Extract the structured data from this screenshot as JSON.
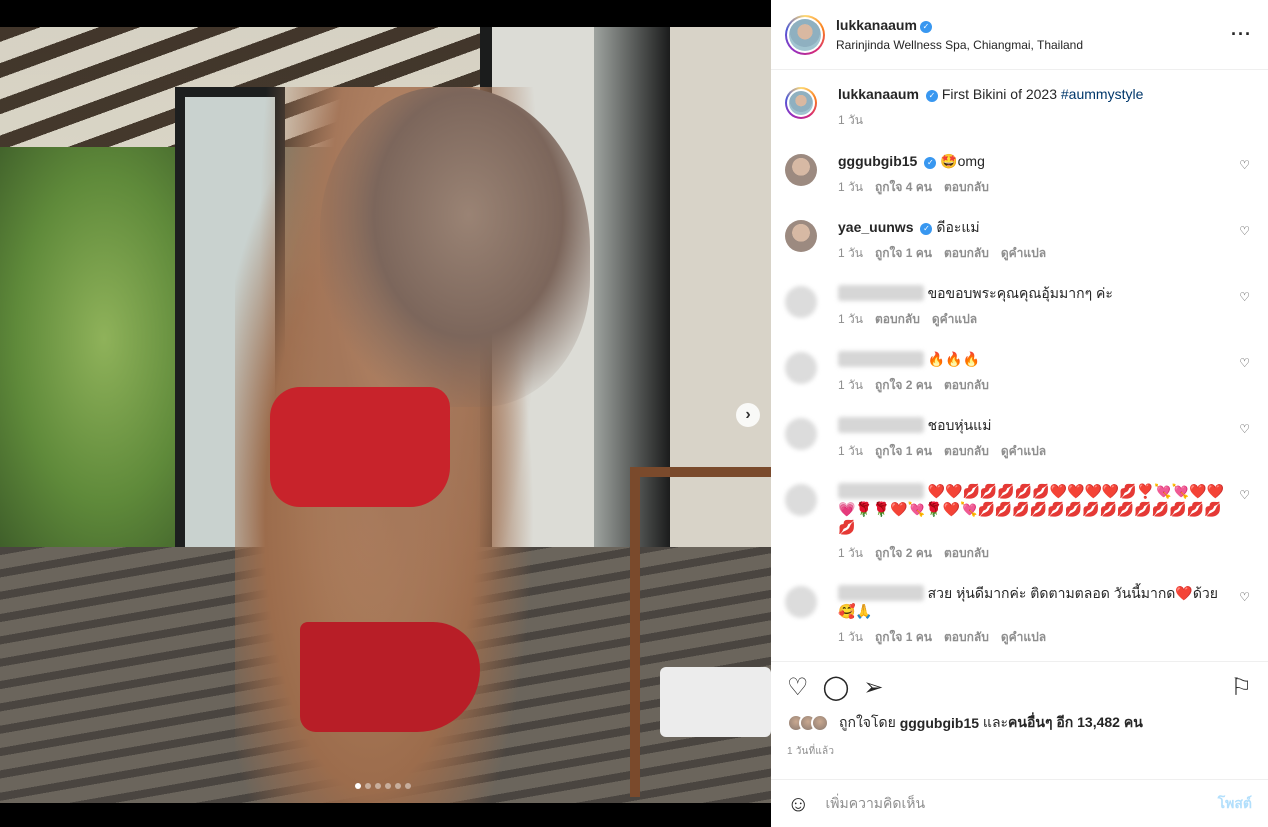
{
  "post": {
    "username": "lukkanaaum",
    "location": "Rarinjinda Wellness Spa, Chiangmai, Thailand",
    "carousel_dots": 6,
    "active_dot": 0
  },
  "caption": {
    "username": "lukkanaaum",
    "text": "First Bikini of 2023",
    "hashtag": "#aummystyle",
    "time": "1 วัน"
  },
  "comments": [
    {
      "username": "gggubgib15",
      "verified": true,
      "text": "🤩omg",
      "time": "1 วัน",
      "likes": "ถูกใจ 4 คน",
      "reply": "ตอบกลับ",
      "translate": ""
    },
    {
      "username": "yae_uunws",
      "verified": true,
      "text": "ดีอะแม่",
      "time": "1 วัน",
      "likes": "ถูกใจ 1 คน",
      "reply": "ตอบกลับ",
      "translate": "ดูคำแปล"
    },
    {
      "username": "",
      "verified": false,
      "text": "ขอขอบพระคุณคุณอุ้มมากๆ ค่ะ",
      "time": "1 วัน",
      "likes": "",
      "reply": "ตอบกลับ",
      "translate": "ดูคำแปล"
    },
    {
      "username": "",
      "verified": false,
      "text": "🔥🔥🔥",
      "time": "1 วัน",
      "likes": "ถูกใจ 2 คน",
      "reply": "ตอบกลับ",
      "translate": ""
    },
    {
      "username": "",
      "verified": false,
      "text": "ชอบหุ่นแม่",
      "time": "1 วัน",
      "likes": "ถูกใจ 1 คน",
      "reply": "ตอบกลับ",
      "translate": "ดูคำแปล"
    },
    {
      "username": "",
      "verified": false,
      "text": "❤️❤️💋💋💋💋💋❤️❤️❤️❤️💋❣️💘💘❤️❤️💗🌹🌹❤️💘🌹❤️💘💋💋💋💋💋💋💋💋💋💋💋💋💋💋💋",
      "time": "1 วัน",
      "likes": "ถูกใจ 2 คน",
      "reply": "ตอบกลับ",
      "translate": ""
    },
    {
      "username": "",
      "verified": false,
      "text": "สวย หุ่นดีมากค่ะ ติดตามตลอด วันนี้มากด❤️ด้วย 🥰🙏",
      "time": "1 วัน",
      "likes": "ถูกใจ 1 คน",
      "reply": "ตอบกลับ",
      "translate": "ดูคำแปล"
    }
  ],
  "actions": {
    "liked_by_prefix": "ถูกใจโดย",
    "liked_by_user": "gggubgib15",
    "liked_by_and": "และ",
    "liked_by_others": "คนอื่นๆ",
    "liked_by_count": "อีก 13,482 คน",
    "posted_time": "1 วันที่แล้ว"
  },
  "add_comment": {
    "placeholder": "เพิ่มความคิดเห็น",
    "post_label": "โพสต์"
  },
  "icons": {
    "more": "more-options-icon",
    "heart": "heart-icon",
    "comment": "comment-icon",
    "share": "share-icon",
    "save": "bookmark-icon",
    "emoji": "emoji-icon",
    "next": "chevron-right-icon"
  },
  "colors": {
    "verified": "#3897f0",
    "hashtag": "#00376b",
    "post_button": "#b2dffc",
    "muted": "#8e8e8e"
  }
}
